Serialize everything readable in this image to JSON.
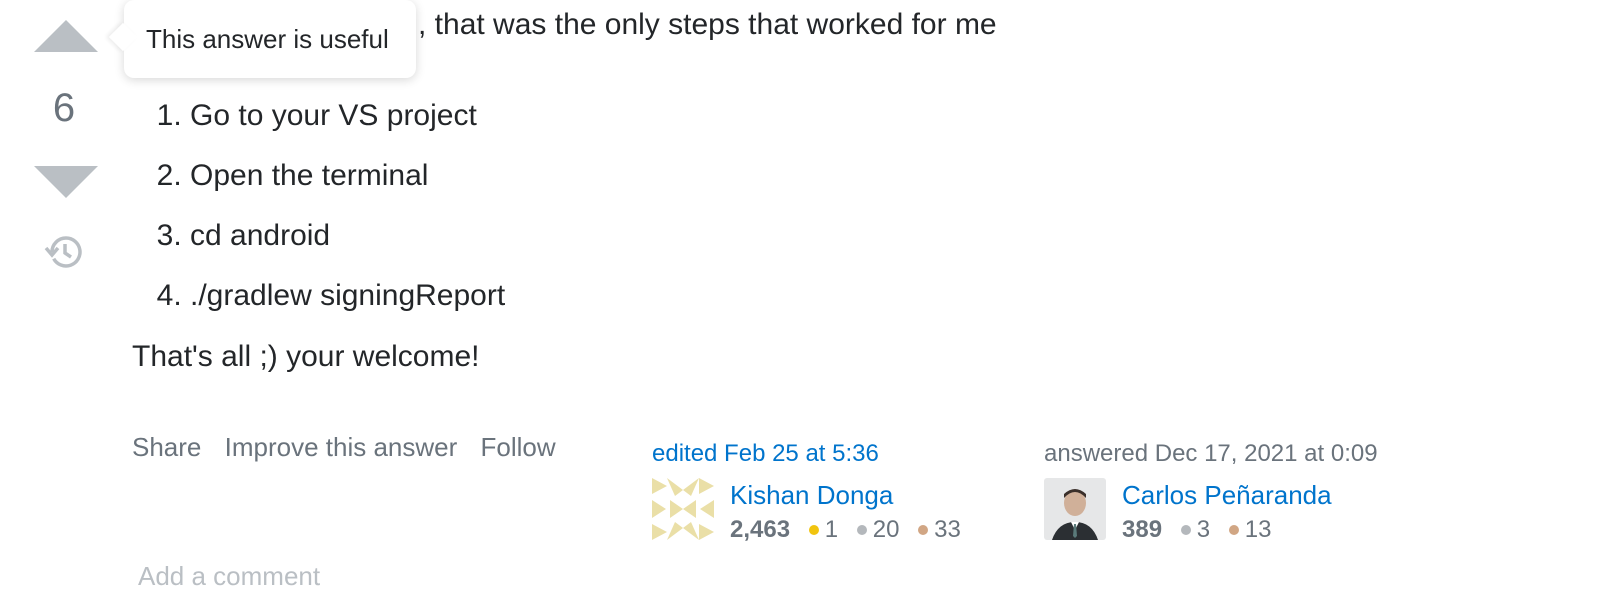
{
  "vote": {
    "count": "6"
  },
  "tooltip": {
    "text": "This answer is useful"
  },
  "answer": {
    "intro": ", that was the only steps that worked for me",
    "steps": [
      "Go to your VS project",
      "Open the terminal",
      "cd android",
      "./gradlew signingReport"
    ],
    "closing": "That's all ;) your welcome!"
  },
  "actions": {
    "share": "Share",
    "improve": "Improve this answer",
    "follow": "Follow"
  },
  "editor": {
    "time_text": "edited Feb 25 at 5:36",
    "name": "Kishan Donga",
    "reputation": "2,463",
    "gold": "1",
    "silver": "20",
    "bronze": "33"
  },
  "owner": {
    "time_text": "answered Dec 17, 2021 at 0:09",
    "name": "Carlos Peñaranda",
    "reputation": "389",
    "silver": "3",
    "bronze": "13"
  },
  "comment": {
    "add_label": "Add a comment"
  },
  "colors": {
    "gold": "#f1c40f",
    "silver": "#b4b8bc",
    "bronze": "#d1a684",
    "link": "#0074cc"
  }
}
